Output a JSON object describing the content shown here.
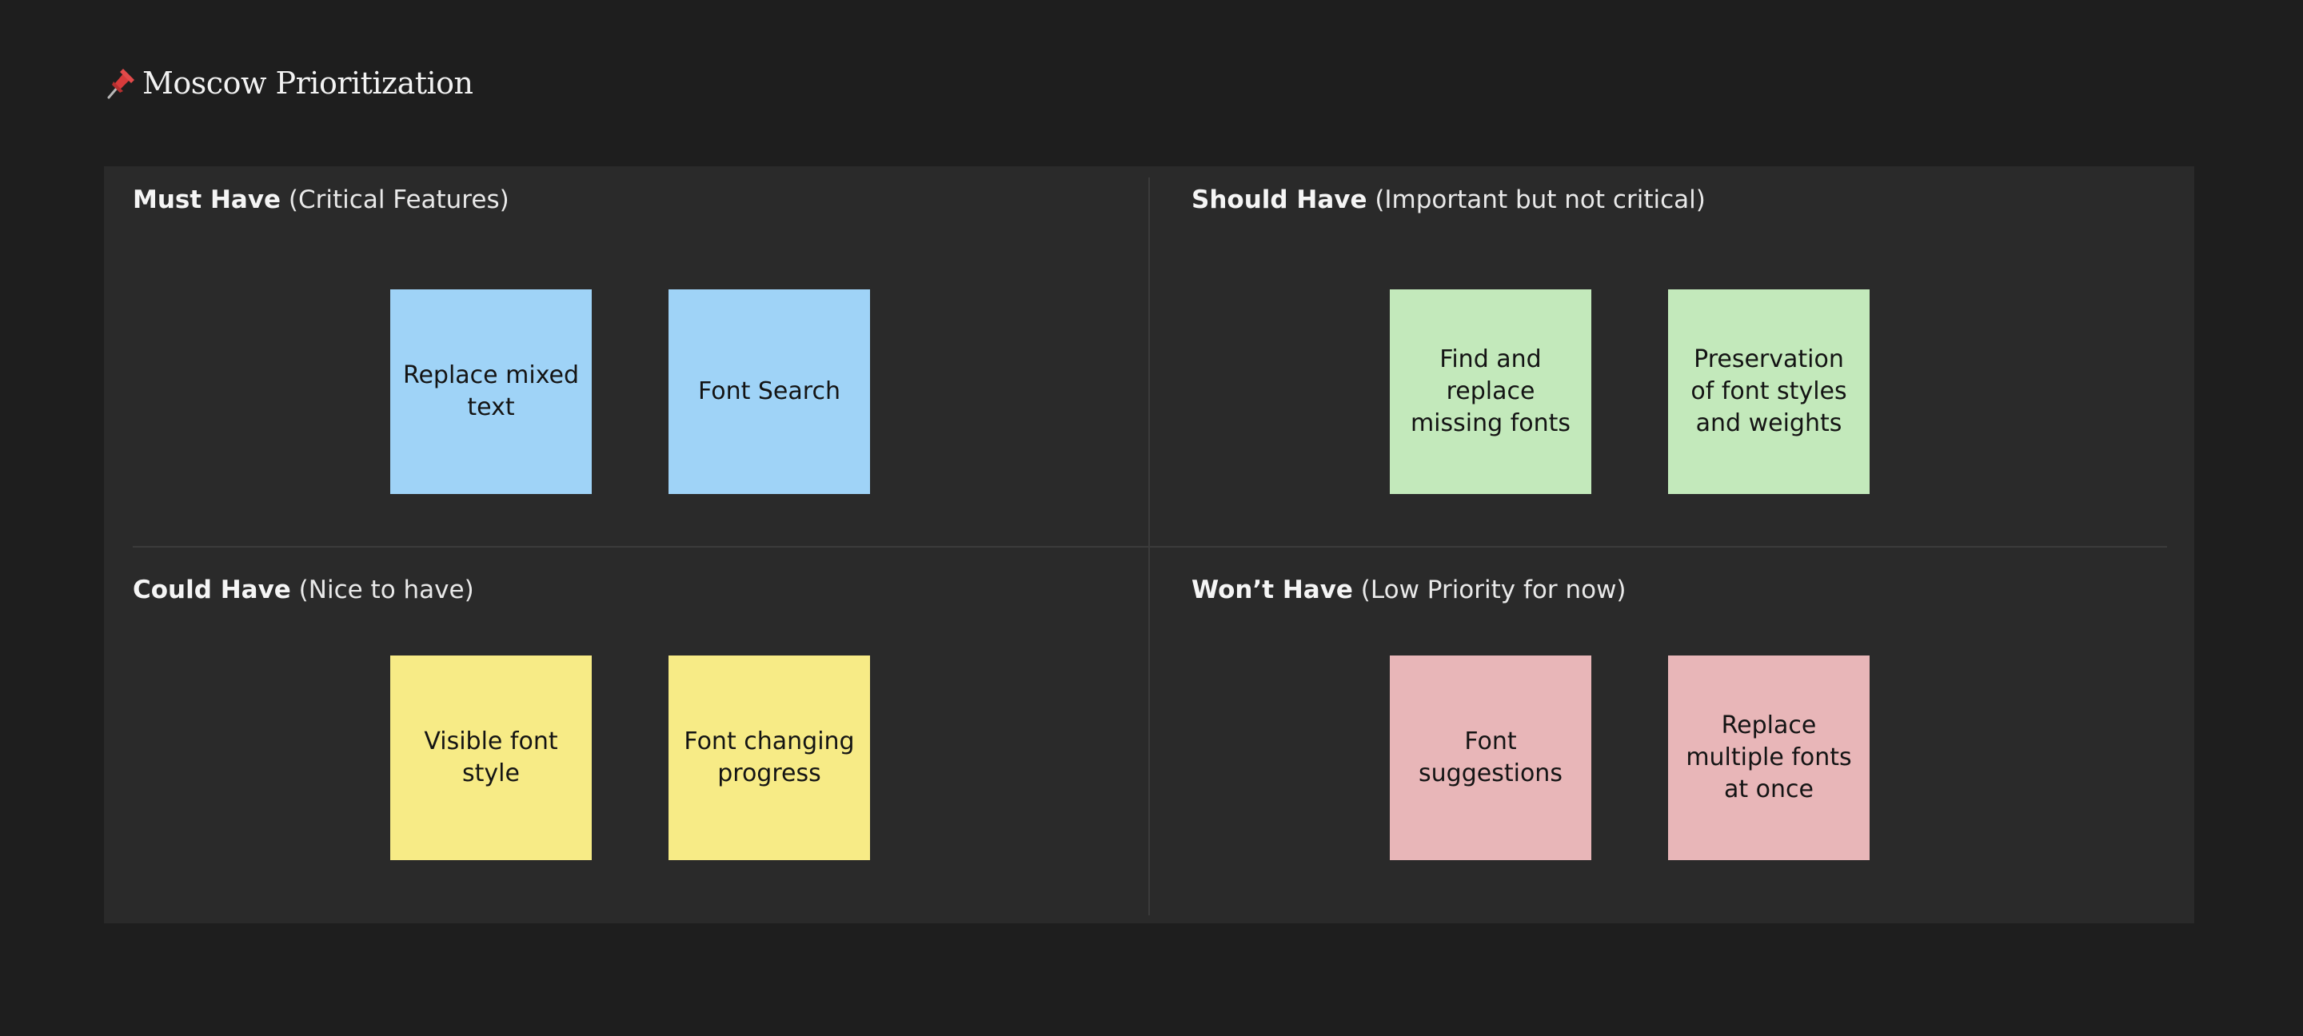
{
  "header": {
    "title": "Moscow Prioritization",
    "icon": "pushpin-icon"
  },
  "quadrants": [
    {
      "id": "must",
      "label_bold": "Must Have",
      "label_rest": " (Critical Features)",
      "color": "#9fd3f7",
      "notes": [
        "Replace mixed text",
        "Font Search"
      ]
    },
    {
      "id": "should",
      "label_bold": "Should Have",
      "label_rest": " (Important but not critical)",
      "color": "#c3e9bb",
      "notes": [
        "Find and replace missing fonts",
        "Preservation of font styles and weights"
      ]
    },
    {
      "id": "could",
      "label_bold": "Could Have",
      "label_rest": " (Nice to have)",
      "color": "#f7eb86",
      "notes": [
        "Visible font style",
        "Font changing progress"
      ]
    },
    {
      "id": "wont",
      "label_bold": "Won’t Have",
      "label_rest": " (Low Priority for now)",
      "color": "#e8b6b8",
      "notes": [
        "Font suggestions",
        "Replace multiple fonts at once"
      ]
    }
  ]
}
